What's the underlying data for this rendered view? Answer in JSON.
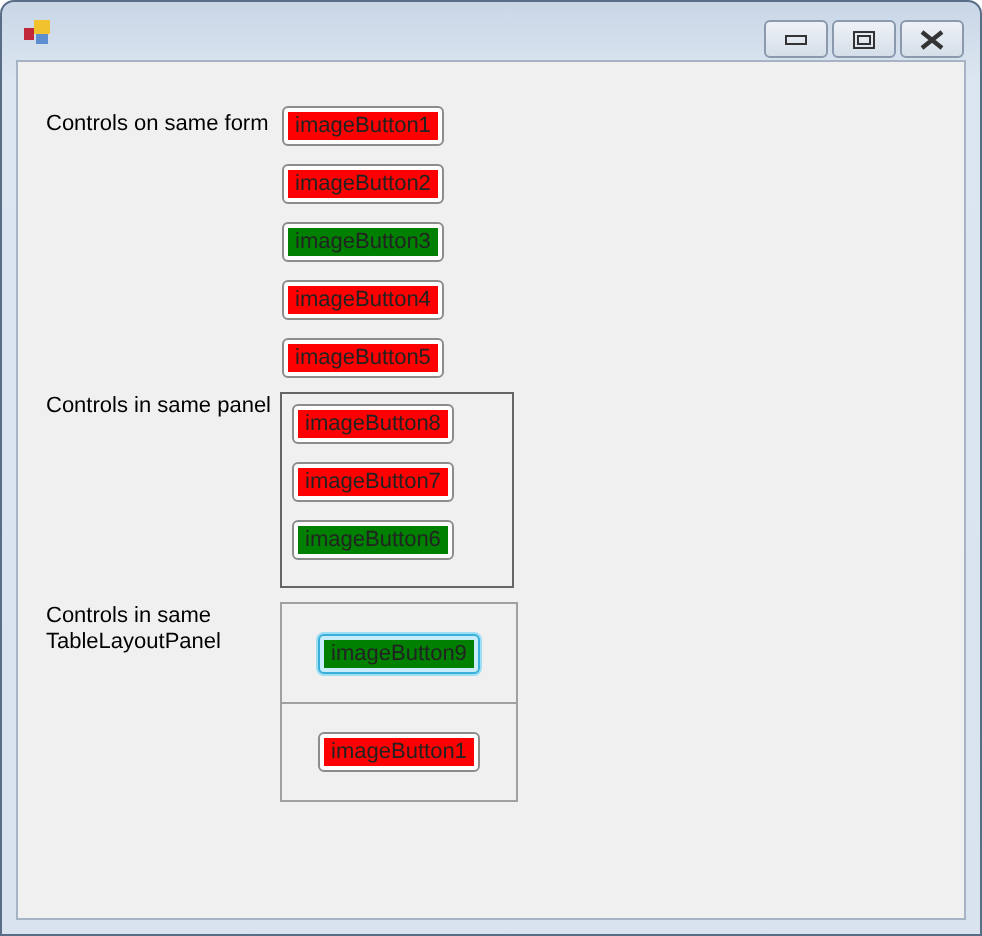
{
  "sections": [
    {
      "kind": "form",
      "label": "Controls on same form",
      "buttons": [
        {
          "text": "imageButton1",
          "color": "#ff0000",
          "focused": false
        },
        {
          "text": "imageButton2",
          "color": "#ff0000",
          "focused": false
        },
        {
          "text": "imageButton3",
          "color": "#008000",
          "focused": false
        },
        {
          "text": "imageButton4",
          "color": "#ff0000",
          "focused": false
        },
        {
          "text": "imageButton5",
          "color": "#ff0000",
          "focused": false
        }
      ]
    },
    {
      "kind": "panel",
      "label": "Controls in same panel",
      "buttons": [
        {
          "text": "imageButton8",
          "color": "#ff0000",
          "focused": false
        },
        {
          "text": "imageButton7",
          "color": "#ff0000",
          "focused": false
        },
        {
          "text": "imageButton6",
          "color": "#008000",
          "focused": false
        }
      ]
    },
    {
      "kind": "table",
      "label": "Controls in same TableLayoutPanel",
      "buttons": [
        {
          "text": "imageButton9",
          "color": "#008000",
          "focused": true
        },
        {
          "text": "imageButton1",
          "color": "#ff0000",
          "focused": false
        }
      ]
    }
  ]
}
